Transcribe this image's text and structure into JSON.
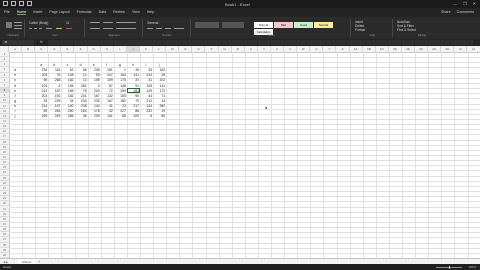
{
  "window": {
    "title": "Book1 - Excel",
    "controls": [
      "—",
      "❐",
      "✕"
    ]
  },
  "ribbon": {
    "tabs": [
      "File",
      "Home",
      "Insert",
      "Page Layout",
      "Formulas",
      "Data",
      "Review",
      "View",
      "Help"
    ],
    "active_tab": "Home",
    "share": "Share",
    "comments": "Comments",
    "font_name": "Calibri (Body)",
    "font_size": "11",
    "number_format": "General",
    "groups": [
      "Clipboard",
      "Font",
      "Alignment",
      "Number",
      "Styles",
      "Cells",
      "Editing"
    ],
    "styles": [
      {
        "label": "Normal",
        "color": "#ffffff"
      },
      {
        "label": "Bad",
        "color": "#f4c7ce"
      },
      {
        "label": "Good",
        "color": "#c6efce"
      },
      {
        "label": "Neutral",
        "color": "#ffeb9c"
      },
      {
        "label": "Calculation",
        "color": "#f2f2f2"
      }
    ],
    "cells_buttons": [
      "Insert",
      "Delete",
      "Format"
    ],
    "editing_buttons": [
      "AutoSum",
      "Sort & Filter",
      "Find & Select"
    ]
  },
  "formula_bar": {
    "name_box": "J8",
    "fx": "fx",
    "value": ""
  },
  "grid": {
    "columns": [
      "A",
      "B",
      "C",
      "D",
      "E",
      "F",
      "G",
      "H",
      "I",
      "J",
      "K",
      "L",
      "M",
      "N",
      "O",
      "P",
      "Q",
      "R",
      "S",
      "T",
      "U",
      "V",
      "W",
      "X",
      "Y",
      "Z",
      "AA",
      "AB",
      "AC",
      "AD",
      "AE",
      "AF",
      "AG",
      "AH",
      "AI",
      "AJ"
    ],
    "rows": [
      "1",
      "2",
      "3",
      "4",
      "5",
      "6",
      "7",
      "8",
      "9",
      "10",
      "11",
      "12",
      "13",
      "14",
      "15",
      "16",
      "17",
      "18",
      "19",
      "20",
      "21",
      "22",
      "23",
      "24",
      "25",
      "26",
      "27",
      "28",
      "29",
      "30",
      "31",
      "32",
      "33",
      "34",
      "35",
      "36",
      "37",
      "38",
      "39",
      "40"
    ],
    "header_row": [
      "a",
      "b",
      "c",
      "d",
      "e",
      "f",
      "g",
      "h",
      "i",
      "j"
    ],
    "row_labels": [
      "a",
      "b",
      "c",
      "d",
      "e",
      "f",
      "g",
      "h",
      "i",
      "j"
    ],
    "data": [
      [
        234,
        116,
        52,
        66,
        205,
        151,
        1,
        49,
        33,
        162
      ],
      [
        203,
        76,
        108,
        12,
        53,
        247,
        164,
        141,
        244,
        28
      ],
      [
        95,
        268,
        182,
        13,
        155,
        109,
        175,
        20,
        31,
        202
      ],
      [
        103,
        5,
        196,
        281,
        4,
        87,
        148,
        51,
        105,
        141
      ],
      [
        212,
        187,
        189,
        75,
        203,
        72,
        190,
        181,
        149,
        172
      ],
      [
        201,
        192,
        182,
        241,
        167,
        132,
        105,
        90,
        44,
        71
      ],
      [
        33,
        225,
        34,
        234,
        235,
        167,
        182,
        79,
        212,
        44
      ],
      [
        214,
        167,
        140,
        238,
        144,
        41,
        23,
        217,
        144,
        282
      ],
      [
        59,
        263,
        250,
        164,
        178,
        42,
        227,
        86,
        232,
        19
      ],
      [
        249,
        249,
        286,
        46,
        209,
        141,
        68,
        109,
        6,
        80
      ]
    ]
  },
  "sheet": {
    "tab": "Sheet1",
    "add": "+",
    "nav": "◀ ▶"
  },
  "status": {
    "ready": "Ready",
    "zoom": "100%"
  }
}
